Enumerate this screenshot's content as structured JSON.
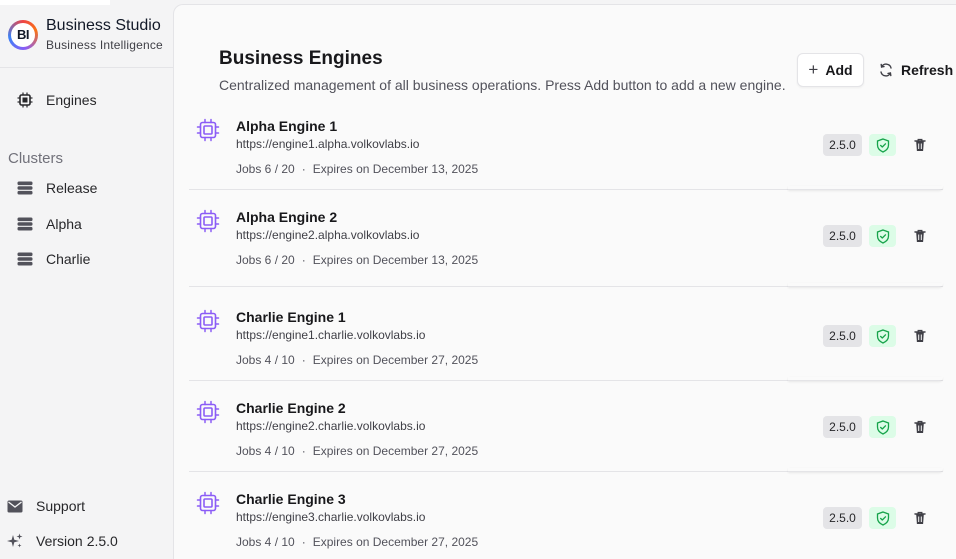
{
  "app": {
    "title": "Business Studio",
    "subtitle": "Business Intelligence",
    "logo_text": "BI"
  },
  "sidebar": {
    "engines_label": "Engines",
    "clusters_heading": "Clusters",
    "clusters": [
      {
        "label": "Release"
      },
      {
        "label": "Alpha"
      },
      {
        "label": "Charlie"
      }
    ],
    "support_label": "Support",
    "version_label": "Version",
    "version_value": "2.5.0"
  },
  "main": {
    "title": "Business Engines",
    "description": "Centralized management of all business operations. Press Add button to add a new engine.",
    "add_label": "Add",
    "refresh_label": "Refresh"
  },
  "engines": [
    {
      "name": "Alpha Engine 1",
      "url": "https://engine1.alpha.volkovlabs.io",
      "jobs": "Jobs 6 / 20",
      "expires": "Expires on December 13, 2025",
      "version": "2.5.0"
    },
    {
      "name": "Alpha Engine 2",
      "url": "https://engine2.alpha.volkovlabs.io",
      "jobs": "Jobs 6 / 20",
      "expires": "Expires on December 13, 2025",
      "version": "2.5.0"
    },
    {
      "name": "Charlie Engine 1",
      "url": "https://engine1.charlie.volkovlabs.io",
      "jobs": "Jobs 4 / 10",
      "expires": "Expires on December 27, 2025",
      "version": "2.5.0"
    },
    {
      "name": "Charlie Engine 2",
      "url": "https://engine2.charlie.volkovlabs.io",
      "jobs": "Jobs 4 / 10",
      "expires": "Expires on December 27, 2025",
      "version": "2.5.0"
    },
    {
      "name": "Charlie Engine 3",
      "url": "https://engine3.charlie.volkovlabs.io",
      "jobs": "Jobs 4 / 10",
      "expires": "Expires on December 27, 2025",
      "version": "2.5.0"
    }
  ],
  "meta_separator": "·",
  "icons": {
    "logo": "bi-logo",
    "engines": "cpu-icon",
    "cluster": "server-stack-icon",
    "support": "envelope-icon",
    "version": "sparkles-icon",
    "add": "plus-icon",
    "refresh": "refresh-icon",
    "engine": "cpu-icon",
    "status": "shield-check-icon",
    "delete": "trash-icon"
  },
  "colors": {
    "accent_purple": "#8b5cf6",
    "status_green_bg": "#dcfce7",
    "status_green": "#16a34a"
  }
}
